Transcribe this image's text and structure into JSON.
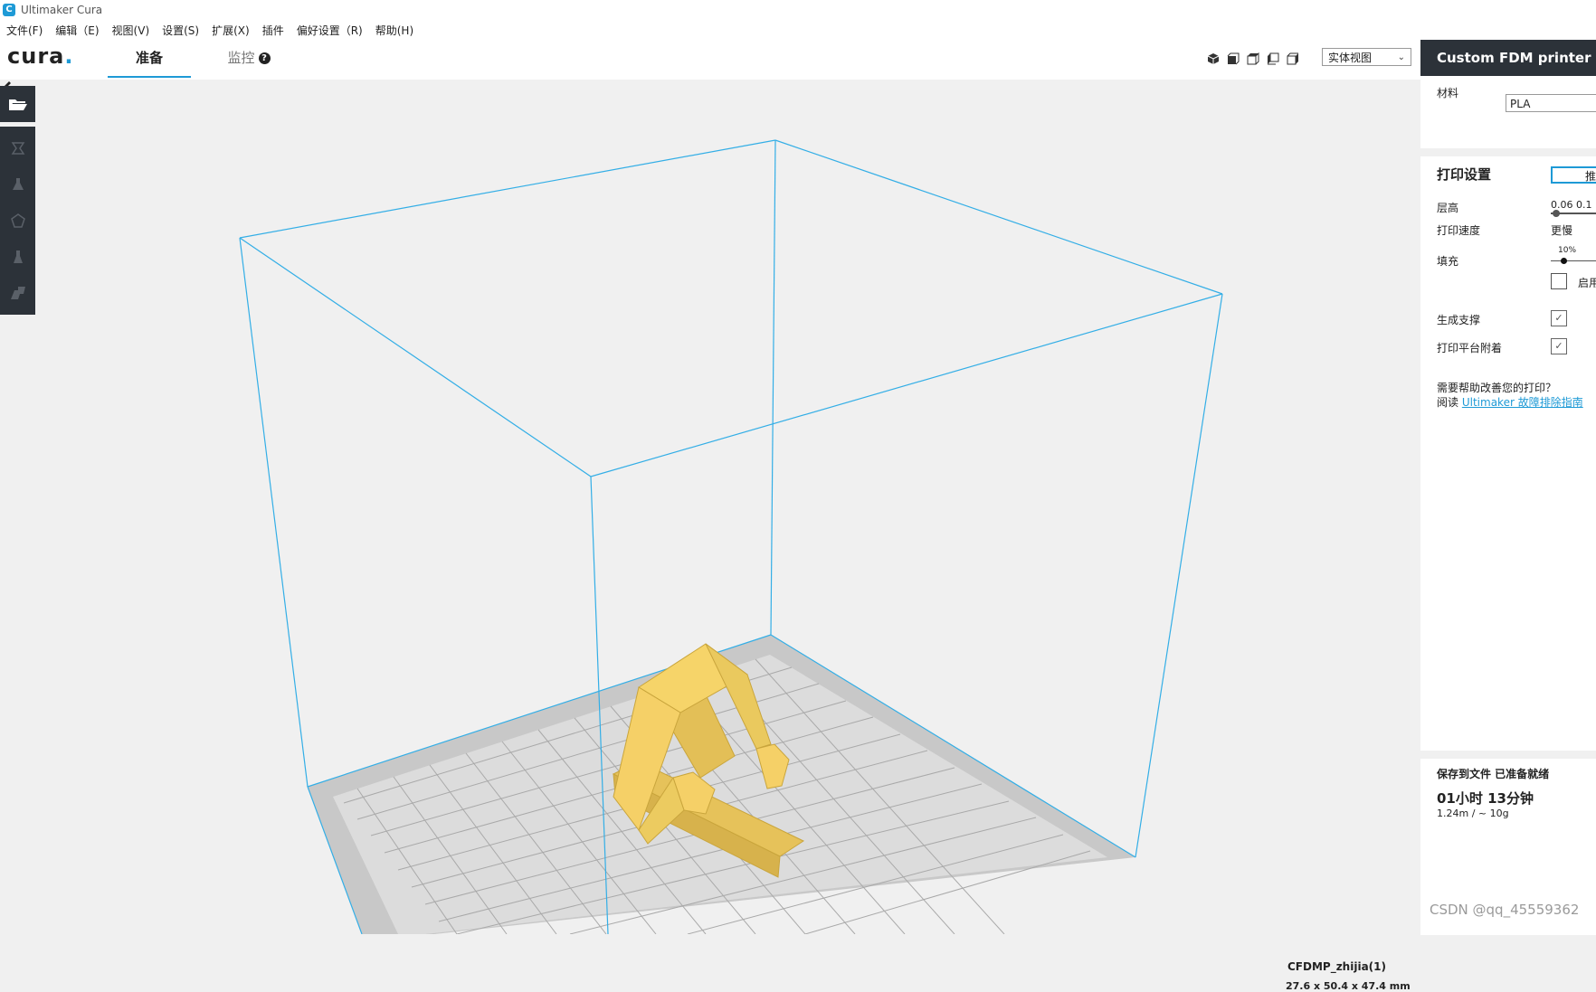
{
  "window": {
    "title": "Ultimaker Cura",
    "logo_glyph": "C"
  },
  "menu": [
    "文件(F)",
    "编辑（E)",
    "视图(V)",
    "设置(S)",
    "扩展(X)",
    "插件",
    "偏好设置（R)",
    "帮助(H)"
  ],
  "toolbar": {
    "logo_text": "cura",
    "logo_dot": ".",
    "tabs": {
      "prepare": "准备",
      "monitor": "监控"
    },
    "help_glyph": "?",
    "view_mode": "实体视图",
    "view_buttons": [
      "3d-view-icon",
      "front-view-icon",
      "top-view-icon",
      "left-view-icon",
      "right-view-icon"
    ]
  },
  "sidebar": {
    "printer_name": "Custom FDM printer",
    "material_label": "材料",
    "material_value": "PLA",
    "print_settings_title": "打印设置",
    "recommended_label": "推荐",
    "layer_height_label": "层高",
    "layer_height_values": "0.06 0.1",
    "print_speed_label": "打印速度",
    "print_speed_value": "更慢",
    "infill_label": "填充",
    "infill_value": "10%",
    "infill_fraction": 0.1,
    "gradual_label": "启用",
    "support_label": "生成支撑",
    "support_checked": true,
    "adhesion_label": "打印平台附着",
    "adhesion_checked": true,
    "help_line1": "需要帮助改善您的打印？",
    "help_read": "阅读",
    "help_link": "Ultimaker 故障排除指南",
    "save_status": "保存到文件 已准备就绪",
    "print_time": "01小时 13分钟",
    "print_usage": "1.24m / ~ 10g",
    "check_glyph": "✓"
  },
  "viewport": {
    "job_name": "CFDMP_zhijia(1)",
    "dimensions": "27.6 x 50.4 x 47.4 mm",
    "model_color": "#f5d067",
    "build_volume_color": "#33aee6"
  },
  "watermark": "CSDN @qq_45559362"
}
